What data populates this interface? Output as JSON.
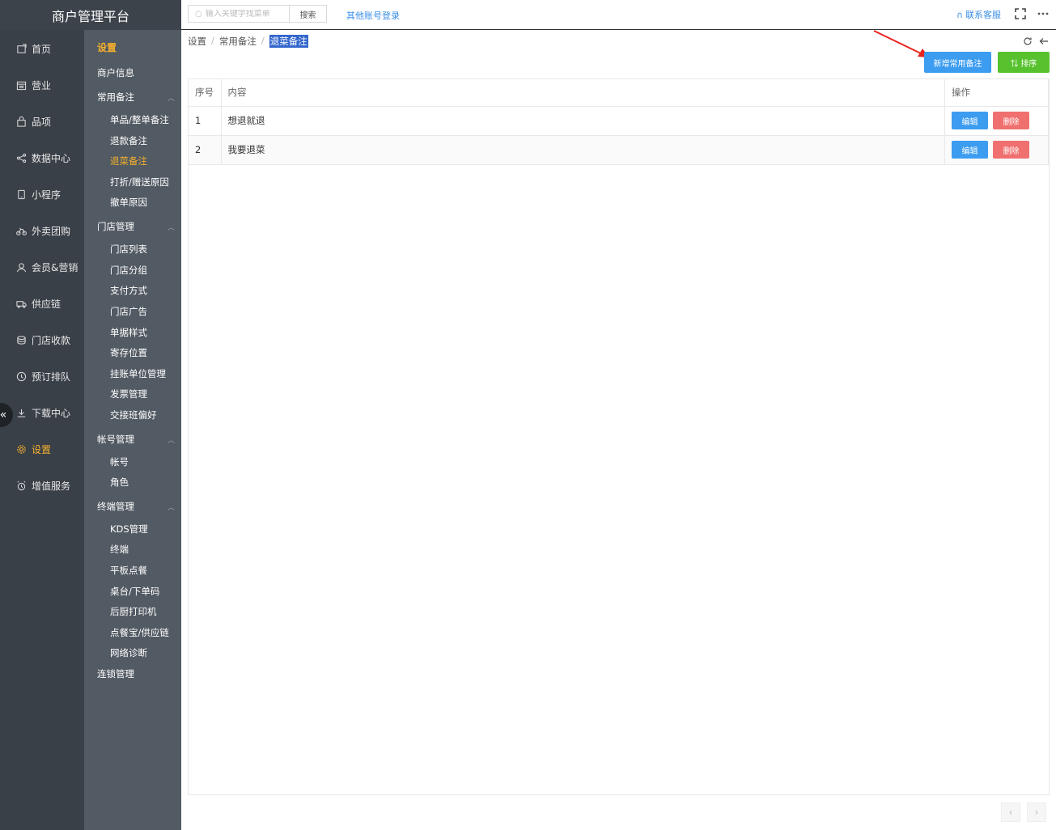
{
  "app": {
    "title": "商户管理平台"
  },
  "topbar": {
    "search_placeholder": "输入关键字找菜单",
    "search_button": "搜索",
    "other_login": "其他账号登录",
    "contact_label": "联系客服"
  },
  "sidebar": {
    "items": [
      {
        "label": "首页",
        "icon": "home-icon"
      },
      {
        "label": "营业",
        "icon": "calendar-icon"
      },
      {
        "label": "品项",
        "icon": "bag-icon"
      },
      {
        "label": "数据中心",
        "icon": "share-icon"
      },
      {
        "label": "小程序",
        "icon": "phone-icon"
      },
      {
        "label": "外卖团购",
        "icon": "bike-icon"
      },
      {
        "label": "会员&营销",
        "icon": "user-icon"
      },
      {
        "label": "供应链",
        "icon": "truck-icon"
      },
      {
        "label": "门店收款",
        "icon": "coins-icon"
      },
      {
        "label": "预订排队",
        "icon": "clock-icon"
      },
      {
        "label": "下载中心",
        "icon": "download-icon"
      },
      {
        "label": "设置",
        "icon": "gear-icon"
      },
      {
        "label": "增值服务",
        "icon": "alarm-icon"
      }
    ],
    "active_index": 11
  },
  "submenu": {
    "title": "设置",
    "merchant_info": "商户信息",
    "groups": {
      "remarks": {
        "label": "常用备注",
        "items": [
          "单品/整单备注",
          "退款备注",
          "退菜备注",
          "打折/赠送原因",
          "撤单原因"
        ]
      },
      "stores": {
        "label": "门店管理",
        "items": [
          "门店列表",
          "门店分组",
          "支付方式",
          "门店广告",
          "单据样式",
          "寄存位置",
          "挂账单位管理",
          "发票管理",
          "交接班偏好"
        ]
      },
      "accounts": {
        "label": "帐号管理",
        "items": [
          "帐号",
          "角色"
        ]
      },
      "terminals": {
        "label": "终端管理",
        "items": [
          "KDS管理",
          "终端",
          "平板点餐",
          "桌台/下单码",
          "后厨打印机",
          "点餐宝/供应链",
          "网络诊断"
        ]
      }
    },
    "chain": "连锁管理"
  },
  "breadcrumb": {
    "level1": "设置",
    "level2": "常用备注",
    "current": "退菜备注"
  },
  "toolbar": {
    "add_label": "新增常用备注",
    "sort_label": "排序"
  },
  "table": {
    "headers": {
      "index": "序号",
      "content": "内容",
      "ops": "操作"
    },
    "rows": [
      {
        "index": "1",
        "content": "想退就退"
      },
      {
        "index": "2",
        "content": "我要退菜"
      }
    ],
    "edit_label": "编辑",
    "delete_label": "删除"
  },
  "colors": {
    "accent": "#f7b12d",
    "primary": "#3b9cf0",
    "success": "#57c22d",
    "danger": "#f07070"
  }
}
